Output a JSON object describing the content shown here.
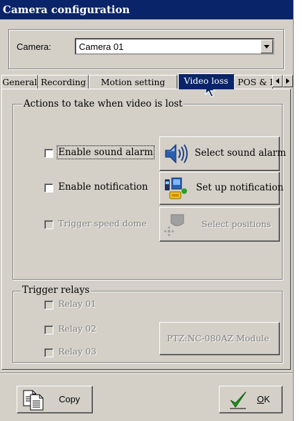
{
  "window": {
    "title": "Camera configuration"
  },
  "camera": {
    "label": "Camera:",
    "value": "Camera 01"
  },
  "tabs": [
    {
      "label": "General"
    },
    {
      "label": "Recording"
    },
    {
      "label": "Motion setting"
    },
    {
      "label": "Video loss",
      "active": true
    },
    {
      "label": "POS & I"
    }
  ],
  "actions_group": {
    "title": "Actions to take when video is lost",
    "items": [
      {
        "label": "Enable sound alarm",
        "checked": false,
        "enabled": true,
        "button": "Select sound alarm",
        "icon": "speaker-icon"
      },
      {
        "label": "Enable notification",
        "checked": false,
        "enabled": true,
        "button": "Set up notification",
        "icon": "notification-icon"
      },
      {
        "label": "Trigger speed dome",
        "checked": false,
        "enabled": false,
        "button": "Select positions",
        "icon": "speed-dome-icon"
      }
    ]
  },
  "relays_group": {
    "title": "Trigger relays",
    "relays": [
      {
        "label": "Relay 01",
        "checked": false,
        "enabled": false
      },
      {
        "label": "Relay 02",
        "checked": false,
        "enabled": false
      },
      {
        "label": "Relay 03",
        "checked": false,
        "enabled": false
      }
    ],
    "module_button": "PTZ:NC-080AZ Module"
  },
  "footer": {
    "copy_label": "Copy",
    "ok_label": "OK"
  },
  "colors": {
    "titlebar": "#0a246a",
    "face": "#d4d0c8",
    "ok_check": "#1a9a1a"
  }
}
